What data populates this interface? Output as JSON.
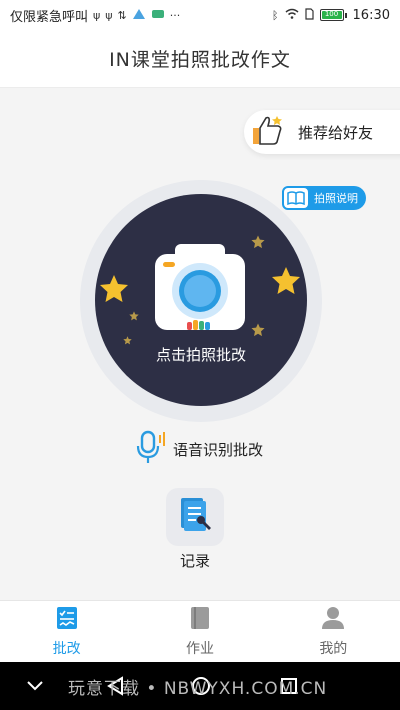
{
  "status_bar": {
    "carrier": "仅限紧急呼叫",
    "icons_left": [
      "usb-icon",
      "usb-icon",
      "data-arrows-icon",
      "app-notification-icon",
      "app-notification-icon",
      "more-dots-icon"
    ],
    "icons_right": [
      "bluetooth-icon",
      "wifi-icon",
      "sim-icon",
      "battery-icon"
    ],
    "battery_level": "100",
    "time": "16:30"
  },
  "header": {
    "title": "IN课堂拍照批改作文"
  },
  "main": {
    "recommend_label": "推荐给好友",
    "help_label": "拍照说明",
    "camera_label": "点击拍照批改",
    "voice_label": "语音识别批改",
    "record_label": "记录"
  },
  "tabbar": {
    "tabs": [
      {
        "label": "批改",
        "icon": "correct-icon",
        "active": true
      },
      {
        "label": "作业",
        "icon": "homework-icon",
        "active": false
      },
      {
        "label": "我的",
        "icon": "profile-icon",
        "active": false
      }
    ]
  },
  "navbar": {
    "watermark": "玩意下载 • NBWYXH.COM.CN"
  },
  "colors": {
    "accent": "#1e9be8",
    "camera_bg": "#2d2f45",
    "star": "#f5c12f"
  }
}
